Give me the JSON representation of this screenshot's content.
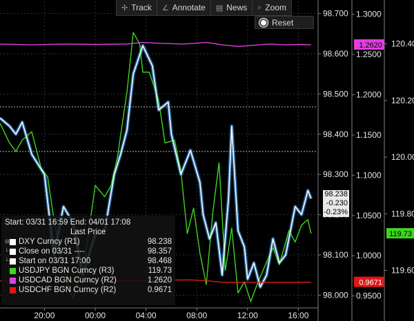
{
  "toolbar": {
    "items": [
      {
        "label": "Track",
        "icon": "crosshair-icon",
        "glyph": "✢"
      },
      {
        "label": "Annotate",
        "icon": "pencil-icon",
        "glyph": "∠"
      },
      {
        "label": "News",
        "icon": "news-icon",
        "glyph": "▤"
      },
      {
        "label": "Zoom",
        "icon": "magnifier-icon",
        "glyph": "⌕"
      }
    ],
    "reset_label": "Reset"
  },
  "legend": {
    "range": "Start: 03/31 16:59 End: 04/01 17:08",
    "subheader": "Last Price",
    "rows": [
      {
        "name": "DXY Curncy  (R1)",
        "value": "98.238",
        "color": "#ffffff",
        "expander": "⊟"
      },
      {
        "name": "Close on 03/31 ----",
        "value": "98.357",
        "color": "#ffffff",
        "expander": "└"
      },
      {
        "name": "Start on 03/31 17:00",
        "value": "98.468",
        "color": "#ffffff",
        "expander": "└"
      },
      {
        "name": "USDJPY BGN Curncy  (R3)",
        "value": "119.73",
        "color": "#3ed61e",
        "expander": ""
      },
      {
        "name": "USDCAD BGN Curncy  (R2)",
        "value": "1.2620",
        "color": "#e040e0",
        "expander": ""
      },
      {
        "name": "USDCHF BGN Curncy  (R2)",
        "value": "0.9671",
        "color": "#e01818",
        "expander": ""
      }
    ]
  },
  "change_box": {
    "price": "98.238",
    "change": "-0.230",
    "pct": "-0.23%"
  },
  "axis_labels": {
    "cad_last": "1.2620",
    "jpy_last": "119.73",
    "chf_last": "0.9671"
  },
  "colors": {
    "dxy": "#ffffff",
    "dxy_fill": "#2f80c8",
    "jpy": "#3ed61e",
    "cad": "#e040e0",
    "chf": "#e01818",
    "ref": "#bbbbbb"
  },
  "chart_data": {
    "type": "line",
    "x_ticks": [
      "20:00",
      "00:00",
      "04:00",
      "08:00",
      "12:00",
      "16:00"
    ],
    "axes": {
      "R1": {
        "ticks": [
          "98.700",
          "98.600",
          "98.500",
          "98.400",
          "98.300",
          "98.200",
          "98.100",
          "98.000"
        ],
        "ylim": [
          97.97,
          98.73
        ]
      },
      "R2": {
        "ticks": [
          "1.3000",
          "1.2500",
          "1.2000",
          "1.1500",
          "1.1000",
          "1.0500",
          "1.0000",
          "0.9500"
        ],
        "ylim": [
          0.936,
          1.316
        ]
      },
      "R3": {
        "ticks": [
          "120.40",
          "120.20",
          "120.00",
          "119.80",
          "119.60"
        ],
        "ylim": [
          119.47,
          120.55
        ]
      }
    },
    "reference_lines": [
      {
        "name": "Close on 03/31",
        "axis": "R1",
        "value": 98.357
      },
      {
        "name": "Start on 03/31 17:00",
        "axis": "R1",
        "value": 98.468
      }
    ],
    "series": [
      {
        "name": "DXY Curncy",
        "axis": "R1",
        "last": 98.238,
        "x": [
          0,
          3,
          5,
          7,
          10,
          14,
          17,
          20,
          23,
          26,
          30,
          33,
          36,
          38,
          40,
          42,
          45,
          48,
          50,
          53,
          54,
          57,
          60,
          63,
          64,
          66,
          68,
          70,
          72,
          73,
          75,
          77,
          78,
          80,
          82,
          84,
          86,
          88,
          90,
          92,
          93,
          95,
          97,
          98
        ],
        "y": [
          98.44,
          98.42,
          98.4,
          98.43,
          98.35,
          98.3,
          98.1,
          98.22,
          98.18,
          98.05,
          98.15,
          98.16,
          98.3,
          98.35,
          98.41,
          98.55,
          98.62,
          98.57,
          98.46,
          98.48,
          98.4,
          98.3,
          98.36,
          98.28,
          98.2,
          98.14,
          98.18,
          98.05,
          98.24,
          98.42,
          98.16,
          98.12,
          98.04,
          98.08,
          98.02,
          98.05,
          98.14,
          98.08,
          98.1,
          98.18,
          98.22,
          98.2,
          98.26,
          98.24
        ]
      },
      {
        "name": "USDJPY BGN Curncy",
        "axis": "R3",
        "last": 119.73,
        "x": [
          0,
          3,
          5,
          7,
          10,
          13,
          15,
          17,
          20,
          23,
          25,
          27,
          30,
          33,
          35,
          37,
          40,
          42,
          44,
          45,
          47,
          50,
          52,
          55,
          57,
          59,
          61,
          63,
          65,
          67,
          69,
          71,
          73,
          75,
          77,
          79,
          81,
          84,
          86,
          88,
          91,
          93,
          95,
          97,
          98
        ],
        "y": [
          120.12,
          120.05,
          120.02,
          120.06,
          120.09,
          119.96,
          119.93,
          119.78,
          119.6,
          119.5,
          119.58,
          119.66,
          119.9,
          119.86,
          119.9,
          120.0,
          120.23,
          120.44,
          120.4,
          120.3,
          120.3,
          120.2,
          120.05,
          120.06,
          119.95,
          119.73,
          119.82,
          119.66,
          119.55,
          119.8,
          119.98,
          119.6,
          119.75,
          119.52,
          119.56,
          119.49,
          119.55,
          119.63,
          119.68,
          119.62,
          119.74,
          119.7,
          119.76,
          119.78,
          119.73
        ]
      },
      {
        "name": "USDCAD BGN Curncy",
        "axis": "R2",
        "last": 1.262,
        "x": [
          0,
          10,
          20,
          30,
          40,
          45,
          50,
          58,
          65,
          70,
          75,
          80,
          85,
          90,
          95,
          98
        ],
        "y": [
          1.263,
          1.262,
          1.263,
          1.2625,
          1.263,
          1.265,
          1.264,
          1.263,
          1.265,
          1.262,
          1.26,
          1.2615,
          1.263,
          1.262,
          1.2625,
          1.262
        ]
      },
      {
        "name": "USDCHF BGN Curncy",
        "axis": "R2",
        "last": 0.9671,
        "x": [
          0,
          20,
          40,
          50,
          60,
          65,
          70,
          80,
          90,
          98
        ],
        "y": [
          0.9685,
          0.9685,
          0.969,
          0.9695,
          0.97,
          0.969,
          0.967,
          0.967,
          0.9668,
          0.9671
        ]
      }
    ]
  }
}
